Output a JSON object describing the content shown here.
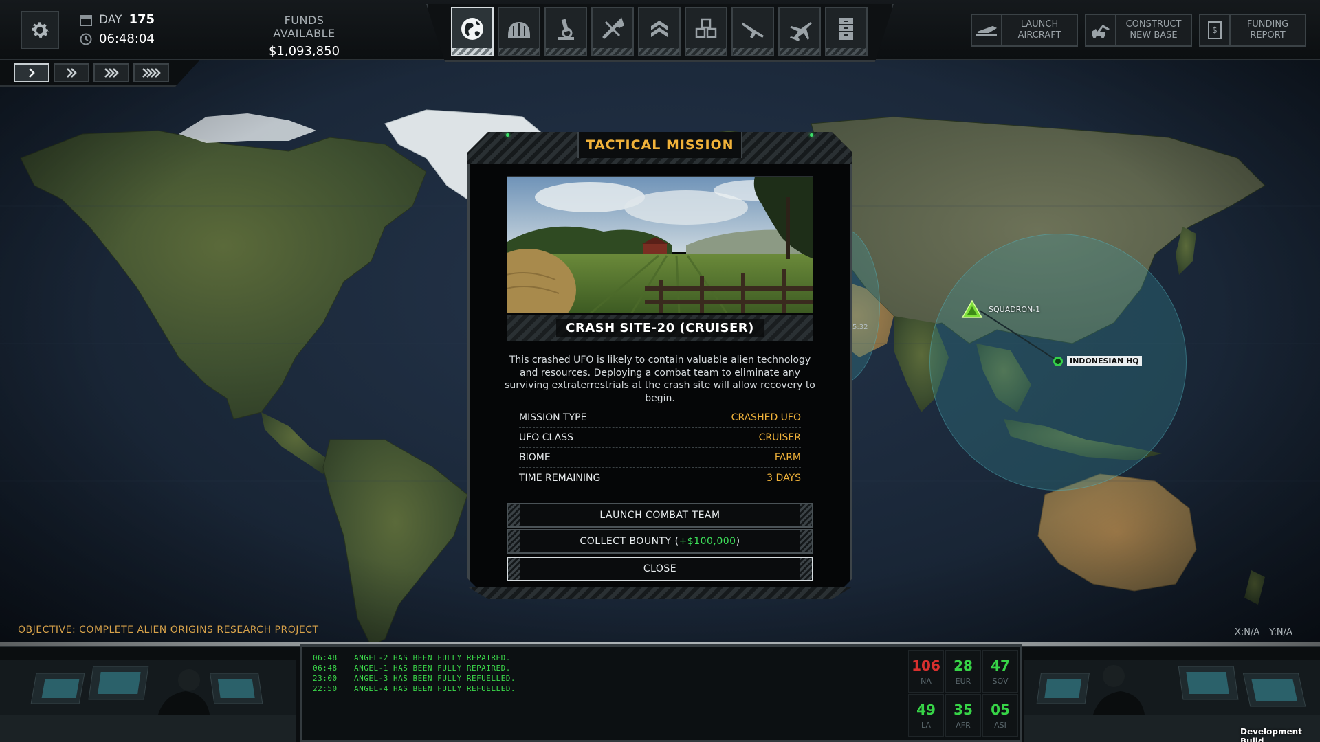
{
  "topbar": {
    "day_label": "DAY",
    "day_value": "175",
    "clock": "06:48:04",
    "funds_label": "FUNDS AVAILABLE",
    "funds_value": "$1,093,850"
  },
  "nav_tabs": [
    {
      "icon": "globe-icon",
      "active": true
    },
    {
      "icon": "base-hangar-icon",
      "active": false
    },
    {
      "icon": "microscope-icon",
      "active": false
    },
    {
      "icon": "engineering-tools-icon",
      "active": false
    },
    {
      "icon": "rank-chevron-icon",
      "active": false
    },
    {
      "icon": "stores-crates-icon",
      "active": false
    },
    {
      "icon": "rifle-icon",
      "active": false
    },
    {
      "icon": "jet-aircraft-icon",
      "active": false
    },
    {
      "icon": "archive-cabinet-icon",
      "active": false
    }
  ],
  "actions": {
    "launch_aircraft": "LAUNCH\nAIRCRAFT",
    "construct_base": "CONSTRUCT\nNEW BASE",
    "funding_report": "FUNDING\nREPORT"
  },
  "speed_controls": [
    {
      "icon": "speed-1-icon",
      "active": true
    },
    {
      "icon": "speed-2-icon",
      "active": false
    },
    {
      "icon": "speed-3-icon",
      "active": false
    },
    {
      "icon": "speed-4-icon",
      "active": false
    }
  ],
  "map": {
    "squadron_label": "SQUADRON-1",
    "hq_label": "INDONESIAN HQ",
    "partial_time": "5:32",
    "objective": "OBJECTIVE: COMPLETE ALIEN ORIGINS RESEARCH PROJECT",
    "coord_x": "X:N/A",
    "coord_y": "Y:N/A",
    "radar_color": "#3896a0",
    "squadron_color": "#7fe03a",
    "hq_color": "#35d04a"
  },
  "modal": {
    "title": "TACTICAL MISSION",
    "site_name": "CRASH SITE-20 (CRUISER)",
    "description": "This crashed UFO is likely to contain valuable alien technology and resources. Deploying a combat team to eliminate any surviving extraterrestrials at the crash site will allow recovery to begin.",
    "details": [
      {
        "key": "MISSION TYPE",
        "value": "CRASHED UFO"
      },
      {
        "key": "UFO CLASS",
        "value": "CRUISER"
      },
      {
        "key": "BIOME",
        "value": "FARM"
      },
      {
        "key": "TIME REMAINING",
        "value": "3 DAYS"
      }
    ],
    "btn_launch": "LAUNCH COMBAT TEAM",
    "btn_bounty_prefix": "COLLECT BOUNTY (",
    "btn_bounty_amount": "+$100,000",
    "btn_bounty_suffix": ")",
    "btn_close": "CLOSE",
    "accent_color": "#f0b23a"
  },
  "log": [
    {
      "time": "06:48",
      "text": "ANGEL-2 HAS BEEN FULLY REPAIRED."
    },
    {
      "time": "06:48",
      "text": "ANGEL-1 HAS BEEN FULLY REPAIRED."
    },
    {
      "time": "23:00",
      "text": "ANGEL-3 HAS BEEN FULLY REFUELLED."
    },
    {
      "time": "22:50",
      "text": "ANGEL-4 HAS BEEN FULLY REFUELLED."
    }
  ],
  "regions": [
    {
      "value": "106",
      "code": "NA",
      "status": "bad"
    },
    {
      "value": "28",
      "code": "EUR",
      "status": "good"
    },
    {
      "value": "47",
      "code": "SOV",
      "status": "good"
    },
    {
      "value": "49",
      "code": "LA",
      "status": "good"
    },
    {
      "value": "35",
      "code": "AFR",
      "status": "good"
    },
    {
      "value": "05",
      "code": "ASI",
      "status": "good"
    }
  ],
  "build_label": "Development Build"
}
